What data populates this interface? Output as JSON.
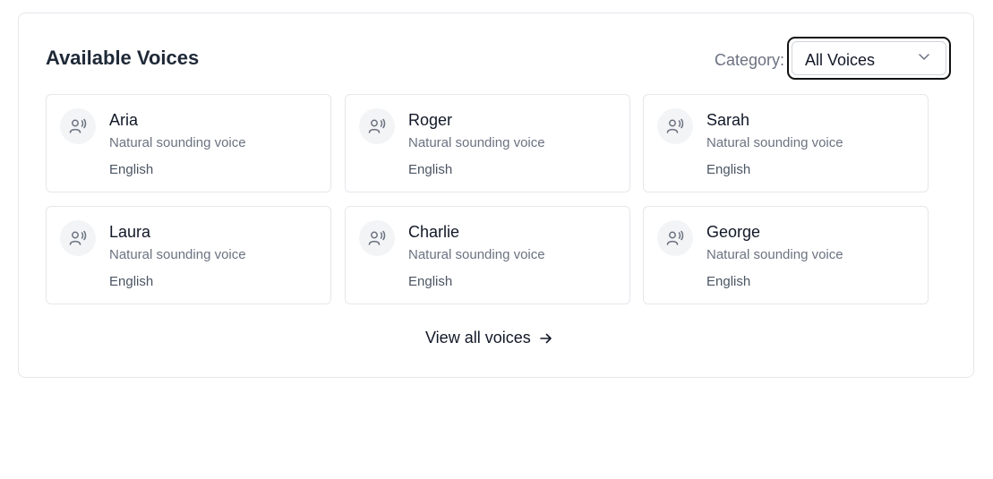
{
  "section": {
    "title": "Available Voices"
  },
  "category": {
    "label": "Category:",
    "selected": "All Voices"
  },
  "voices": [
    {
      "name": "Aria",
      "description": "Natural sounding voice",
      "language": "English"
    },
    {
      "name": "Roger",
      "description": "Natural sounding voice",
      "language": "English"
    },
    {
      "name": "Sarah",
      "description": "Natural sounding voice",
      "language": "English"
    },
    {
      "name": "Laura",
      "description": "Natural sounding voice",
      "language": "English"
    },
    {
      "name": "Charlie",
      "description": "Natural sounding voice",
      "language": "English"
    },
    {
      "name": "George",
      "description": "Natural sounding voice",
      "language": "English"
    }
  ],
  "footer": {
    "view_all_label": "View all voices"
  },
  "icons": {
    "voice": "user-voice-icon",
    "dropdown": "chevron-down-icon",
    "arrow": "arrow-right-icon"
  }
}
